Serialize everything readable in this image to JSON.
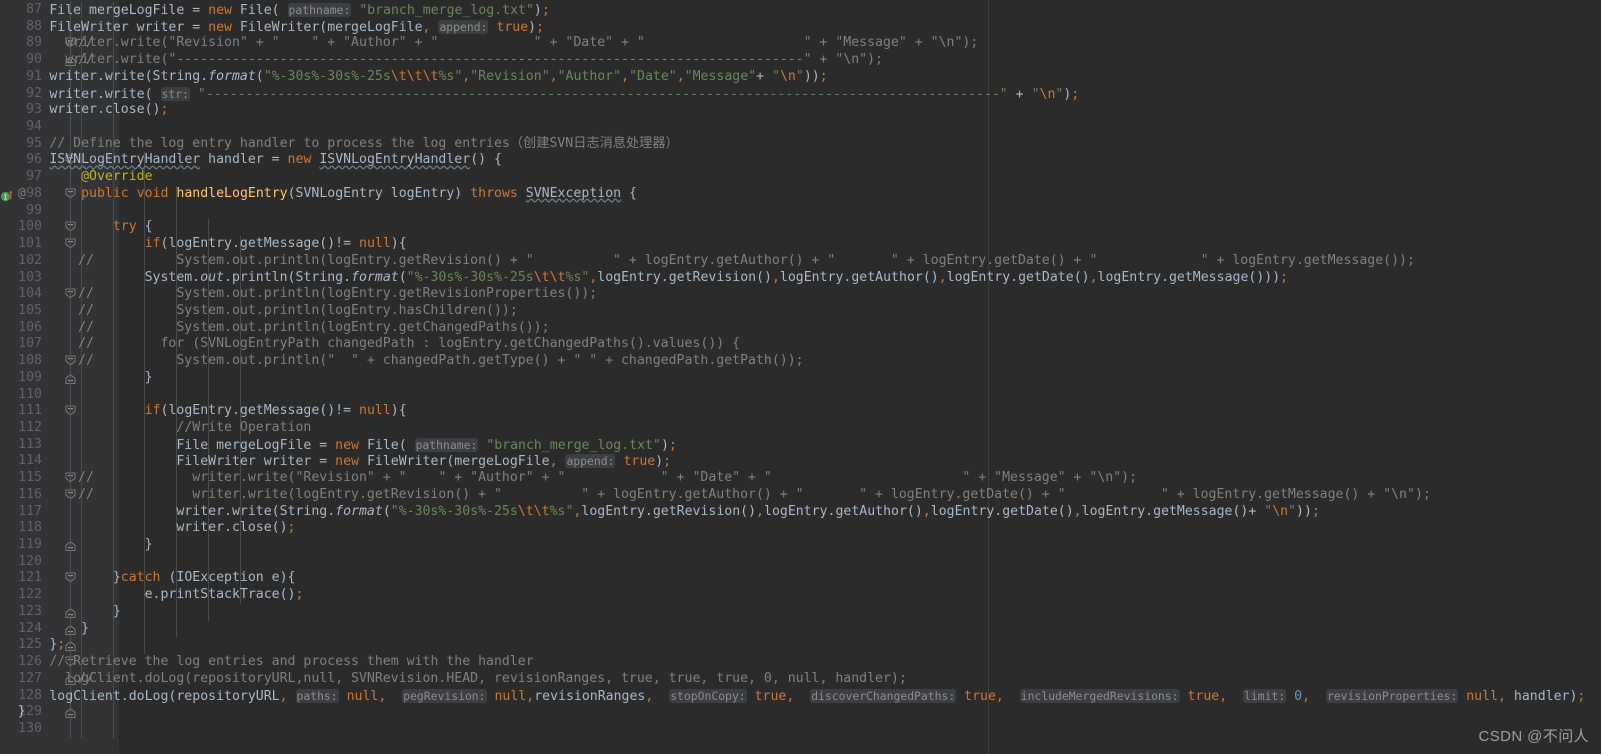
{
  "editor": {
    "theme": "darcula",
    "background": "#2b2b2b",
    "gutter_background": "#313335",
    "font_size_px": 13.2,
    "line_height_px": 16.72,
    "first_line": 87,
    "last_line": 130,
    "watermark": "CSDN @不问人",
    "colors": {
      "keyword": "#cc7832",
      "string": "#6a8759",
      "comment": "#808080",
      "plain_text": "#a9b7c6",
      "method_name": "#ffc66d",
      "field_italic": "#9876aa",
      "annotation": "#bbb529",
      "number": "#6897bb",
      "line_number": "#606366",
      "indent_guide": "#4b4b4b",
      "param_hint_bg": "#3c3f41",
      "param_hint_fg": "#8c8c8c"
    }
  },
  "lines": [
    {
      "n": 87,
      "fold": "none",
      "comment_marker": "",
      "icons": []
    },
    {
      "n": 88,
      "fold": "none",
      "comment_marker": "",
      "icons": []
    },
    {
      "n": 89,
      "fold": "open",
      "comment_marker": "//",
      "icons": []
    },
    {
      "n": 90,
      "fold": "end",
      "comment_marker": "//",
      "icons": []
    },
    {
      "n": 91,
      "fold": "none",
      "comment_marker": "",
      "icons": []
    },
    {
      "n": 92,
      "fold": "none",
      "comment_marker": "",
      "icons": []
    },
    {
      "n": 93,
      "fold": "none",
      "comment_marker": "",
      "icons": []
    },
    {
      "n": 94,
      "fold": "none",
      "comment_marker": "",
      "icons": []
    },
    {
      "n": 95,
      "fold": "none",
      "comment_marker": "",
      "icons": []
    },
    {
      "n": 96,
      "fold": "open",
      "comment_marker": "",
      "icons": []
    },
    {
      "n": 97,
      "fold": "none",
      "comment_marker": "",
      "icons": []
    },
    {
      "n": 98,
      "fold": "open",
      "comment_marker": "",
      "icons": [
        "implementing-method-icon",
        "at-icon"
      ]
    },
    {
      "n": 99,
      "fold": "none",
      "comment_marker": "",
      "icons": []
    },
    {
      "n": 100,
      "fold": "open",
      "comment_marker": "",
      "icons": []
    },
    {
      "n": 101,
      "fold": "open",
      "comment_marker": "",
      "icons": []
    },
    {
      "n": 102,
      "fold": "none",
      "comment_marker": "//",
      "icons": []
    },
    {
      "n": 103,
      "fold": "none",
      "comment_marker": "",
      "icons": []
    },
    {
      "n": 104,
      "fold": "open",
      "comment_marker": "//",
      "icons": []
    },
    {
      "n": 105,
      "fold": "none",
      "comment_marker": "//",
      "icons": []
    },
    {
      "n": 106,
      "fold": "none",
      "comment_marker": "//",
      "icons": []
    },
    {
      "n": 107,
      "fold": "none",
      "comment_marker": "//",
      "icons": []
    },
    {
      "n": 108,
      "fold": "open",
      "comment_marker": "//",
      "icons": []
    },
    {
      "n": 109,
      "fold": "end",
      "comment_marker": "",
      "icons": []
    },
    {
      "n": 110,
      "fold": "none",
      "comment_marker": "",
      "icons": []
    },
    {
      "n": 111,
      "fold": "open",
      "comment_marker": "",
      "icons": []
    },
    {
      "n": 112,
      "fold": "none",
      "comment_marker": "",
      "icons": []
    },
    {
      "n": 113,
      "fold": "none",
      "comment_marker": "",
      "icons": []
    },
    {
      "n": 114,
      "fold": "none",
      "comment_marker": "",
      "icons": []
    },
    {
      "n": 115,
      "fold": "open",
      "comment_marker": "//",
      "icons": []
    },
    {
      "n": 116,
      "fold": "open",
      "comment_marker": "//",
      "icons": []
    },
    {
      "n": 117,
      "fold": "none",
      "comment_marker": "",
      "icons": []
    },
    {
      "n": 118,
      "fold": "none",
      "comment_marker": "",
      "icons": []
    },
    {
      "n": 119,
      "fold": "end",
      "comment_marker": "",
      "icons": []
    },
    {
      "n": 120,
      "fold": "none",
      "comment_marker": "",
      "icons": []
    },
    {
      "n": 121,
      "fold": "open",
      "comment_marker": "",
      "icons": []
    },
    {
      "n": 122,
      "fold": "none",
      "comment_marker": "",
      "icons": []
    },
    {
      "n": 123,
      "fold": "end",
      "comment_marker": "",
      "icons": []
    },
    {
      "n": 124,
      "fold": "end",
      "comment_marker": "",
      "icons": []
    },
    {
      "n": 125,
      "fold": "end",
      "comment_marker": "",
      "icons": []
    },
    {
      "n": 126,
      "fold": "open",
      "comment_marker": "",
      "icons": []
    },
    {
      "n": 127,
      "fold": "end",
      "comment_marker": "//",
      "icons": []
    },
    {
      "n": 128,
      "fold": "none",
      "comment_marker": "",
      "icons": []
    },
    {
      "n": 129,
      "fold": "end",
      "comment_marker": "",
      "icons": []
    },
    {
      "n": 130,
      "fold": "none",
      "comment_marker": "",
      "icons": []
    }
  ],
  "code": {
    "l87": "            File mergeLogFile = new File( pathname: \"branch_merge_log.txt\");",
    "l88": "            FileWriter writer = new FileWriter(mergeLogFile, append: true);",
    "l89": "              writer.write(\"Revision\" + \"    \" + \"Author\" + \"            \" + \"Date\" + \"                    \" + \"Message\" + \"\\n\");",
    "l90": "              writer.write(\"-------------------------------------------------------------------------------\" + \"\\n\");",
    "l91": "            writer.write(String.format(\"%-30s%-30s%-25s\\t\\t\\t%s\",\"Revision\",\"Author\",\"Date\",\"Message\"+ \"\\n\"));",
    "l92": "            writer.write( str: \"----------------------------------------------------------------------------------------------------\" + \"\\n\");",
    "l93": "            writer.close();",
    "l94": "",
    "l95": "            // Define the log entry handler to process the log entries（创建SVN日志消息处理器）",
    "l96": "            ISVNLogEntryHandler handler = new ISVNLogEntryHandler() {",
    "l97": "                @Override",
    "l98": "                public void handleLogEntry(SVNLogEntry logEntry) throws SVNException {",
    "l99": "",
    "l100": "                    try {",
    "l101": "                        if(logEntry.getMessage()!= null){",
    "l102": "                            System.out.println(logEntry.getRevision() + \"          \" + logEntry.getAuthor() + \"       \" + logEntry.getDate() + \"             \" + logEntry.getMessage());",
    "l103": "                        System.out.println(String.format(\"%-30s%-30s%-25s\\t\\t%s\",logEntry.getRevision(),logEntry.getAuthor(),logEntry.getDate(),logEntry.getMessage()));",
    "l104": "                            System.out.println(logEntry.getRevisionProperties());",
    "l105": "                            System.out.println(logEntry.hasChildren());",
    "l106": "                            System.out.println(logEntry.getChangedPaths());",
    "l107": "                          for (SVNLogEntryPath changedPath : logEntry.getChangedPaths().values()) {",
    "l108": "                            System.out.println(\"  \" + changedPath.getType() + \" \" + changedPath.getPath());",
    "l109": "                        }",
    "l110": "",
    "l111": "                        if(logEntry.getMessage()!= null){",
    "l112": "                            //Write Operation",
    "l113": "                            File mergeLogFile = new File( pathname: \"branch_merge_log.txt\");",
    "l114": "                            FileWriter writer = new FileWriter(mergeLogFile, append: true);",
    "l115": "                              writer.write(\"Revision\" + \"    \" + \"Author\" + \"            \" + \"Date\" + \"                        \" + \"Message\" + \"\\n\");",
    "l116": "                              writer.write(logEntry.getRevision() + \"          \" + logEntry.getAuthor() + \"       \" + logEntry.getDate() + \"            \" + logEntry.getMessage() + \"\\n\");",
    "l117": "                            writer.write(String.format(\"%-30s%-30s%-25s\\t\\t%s\",logEntry.getRevision(),logEntry.getAuthor(),logEntry.getDate(),logEntry.getMessage()+ \"\\n\"));",
    "l118": "                            writer.close();",
    "l119": "                        }",
    "l120": "",
    "l121": "                    }catch (IOException e){",
    "l122": "                        e.printStackTrace();",
    "l123": "                    }",
    "l124": "                }",
    "l125": "            };",
    "l126": "            // Retrieve the log entries and process them with the handler",
    "l127": "              logClient.doLog(repositoryURL,null, SVNRevision.HEAD, revisionRanges, true, true, true, 0, null, handler);",
    "l128": "            logClient.doLog(repositoryURL, paths: null,  pegRevision: null,revisionRanges,  stopOnCopy: true,  discoverChangedPaths: true,  includeMergedRevisions: true,  limit: 0,  revisionProperties: null, handler);",
    "l129": "        }",
    "l130": "    }"
  },
  "parameter_hints": [
    "pathname:",
    "append:",
    "str:",
    "paths:",
    "pegRevision:",
    "stopOnCopy:",
    "discoverChangedPaths:",
    "includeMergedRevisions:",
    "limit:",
    "revisionProperties:"
  ]
}
